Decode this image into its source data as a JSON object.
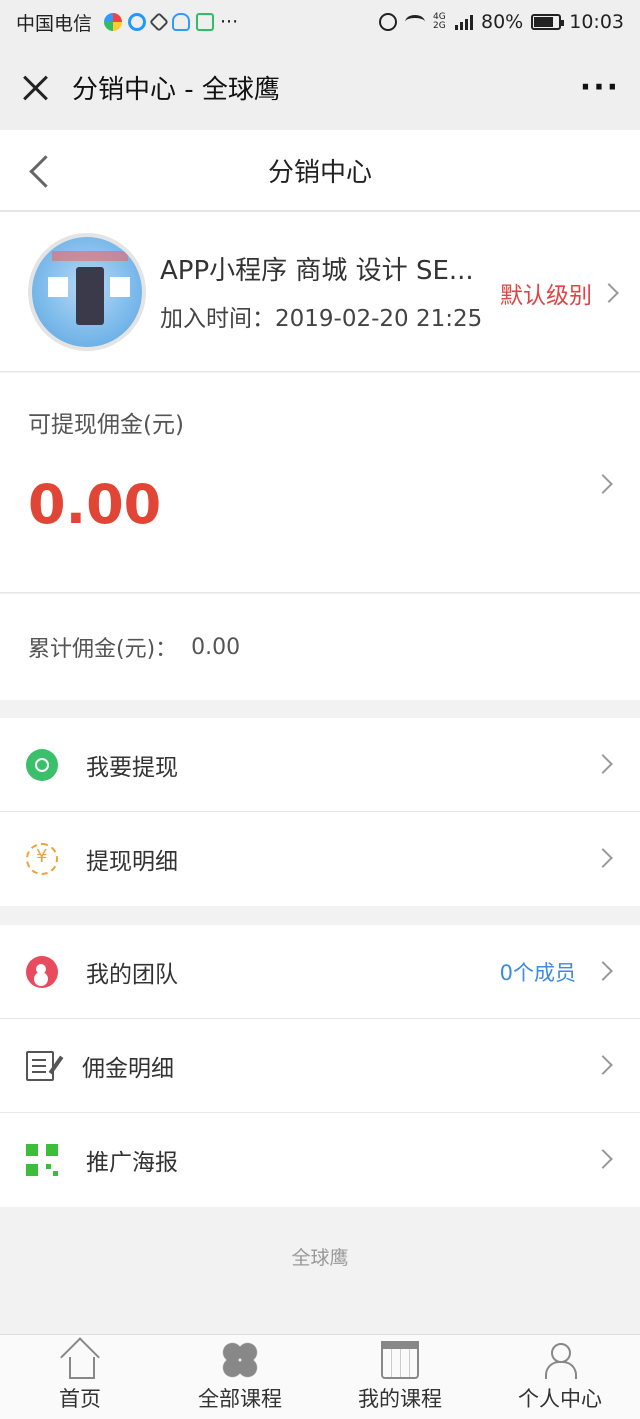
{
  "status_bar": {
    "carrier": "中国电信",
    "more": "···",
    "network": "4G 2G",
    "battery": "80%",
    "battery_level": 0.8,
    "time": "10:03"
  },
  "titlebar": {
    "title": "分销中心 - 全球鹰",
    "more": "···"
  },
  "page": {
    "title": "分销中心"
  },
  "profile": {
    "name": "APP小程序 商城 设计 SE...",
    "join_label": "加入时间：",
    "join_time": "2019-02-20 21:25",
    "level": "默认级别"
  },
  "commission": {
    "label": "可提现佣金(元)",
    "amount": "0.00"
  },
  "total": {
    "label": "累计佣金(元)：",
    "value": "0.00"
  },
  "menu_group_1": [
    {
      "label": "我要提现",
      "icon": "withdraw-icon"
    },
    {
      "label": "提现明细",
      "icon": "yuan-cycle-icon"
    }
  ],
  "menu_group_2": [
    {
      "label": "我的团队",
      "icon": "team-icon",
      "extra": "0个成员"
    },
    {
      "label": "佣金明细",
      "icon": "edit-document-icon"
    },
    {
      "label": "推广海报",
      "icon": "qr-code-icon"
    }
  ],
  "footer": {
    "text": "全球鹰"
  },
  "tabbar": [
    {
      "label": "首页",
      "icon": "home-icon"
    },
    {
      "label": "全部课程",
      "icon": "clover-icon"
    },
    {
      "label": "我的课程",
      "icon": "calendar-icon"
    },
    {
      "label": "个人中心",
      "icon": "user-icon"
    }
  ],
  "colors": {
    "accent_red": "#e04535",
    "link_blue": "#3d8be0",
    "green": "#3bbf6a"
  }
}
